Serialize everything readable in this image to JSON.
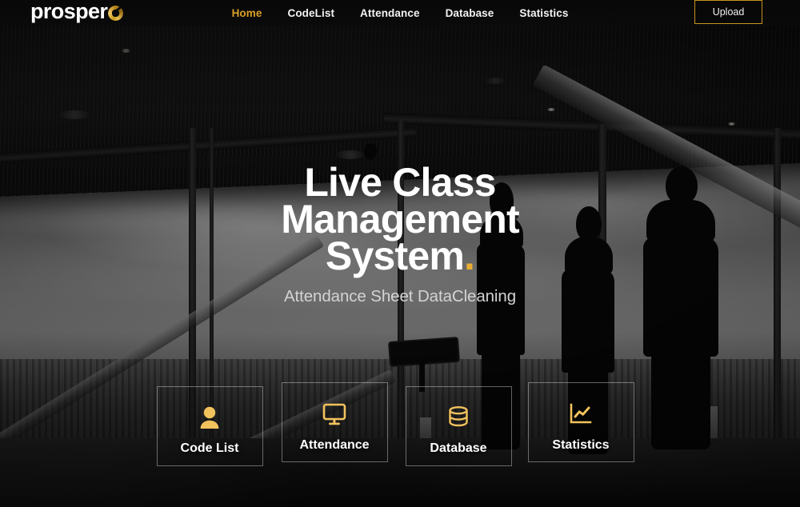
{
  "brand": {
    "name": "prospero",
    "name_text": "prosper",
    "ring_icon": "ring-o-icon",
    "accent_color": "#d9a028"
  },
  "nav": {
    "links": [
      {
        "label": "Home",
        "active": true
      },
      {
        "label": "CodeList",
        "active": false
      },
      {
        "label": "Attendance",
        "active": false
      },
      {
        "label": "Database",
        "active": false
      },
      {
        "label": "Statistics",
        "active": false
      }
    ],
    "upload_label": "Upload"
  },
  "hero": {
    "title_line1": "Live Class",
    "title_line2": "Management",
    "title_line3": "System",
    "title_dot": ".",
    "subtitle": "Attendance Sheet DataCleaning"
  },
  "cards": [
    {
      "label": "Code List",
      "icon": "user-icon"
    },
    {
      "label": "Attendance",
      "icon": "monitor-icon"
    },
    {
      "label": "Database",
      "icon": "database-icon"
    },
    {
      "label": "Statistics",
      "icon": "chart-line-icon"
    }
  ],
  "colors": {
    "accent_gold": "#d9a028",
    "icon_gold": "#f2c25c",
    "text_white": "#ffffff",
    "subtitle_gray": "#d3d3d3",
    "background_dark": "#0b0b0b"
  }
}
